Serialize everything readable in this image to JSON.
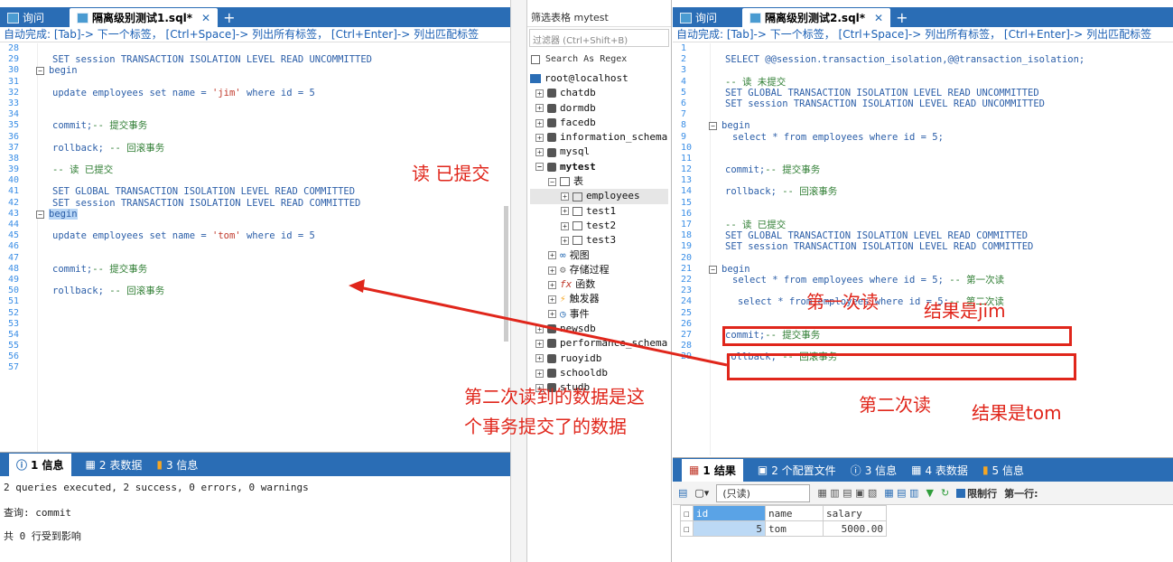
{
  "left": {
    "tabs": [
      "询问",
      "隔离级别测试1.sql*"
    ],
    "hint": "自动完成: [Tab]-> 下一个标签， [Ctrl+Space]-> 列出所有标签， [Ctrl+Enter]-> 列出匹配标签",
    "line_numbers": [
      "28",
      "29",
      "30",
      "31",
      "32",
      "33",
      "34",
      "35",
      "36",
      "37",
      "38",
      "39",
      "40",
      "41",
      "42",
      "43",
      "44",
      "45",
      "46",
      "47",
      "48",
      "49",
      "50",
      "51",
      "52",
      "53",
      "54",
      "55",
      "56",
      "57"
    ],
    "code": {
      "l29": "SET session TRANSACTION ISOLATION LEVEL READ UNCOMMITTED",
      "l30": "begin",
      "l32a": "update employees set name = ",
      "l32s": "'jim'",
      "l32b": " where id = 5",
      "l35a": "commit;",
      "l35b": "-- 提交事务",
      "l37a": "rollback;",
      "l37b": " -- 回滚事务",
      "l39": "-- 读 已提交",
      "l41": "SET GLOBAL TRANSACTION ISOLATION LEVEL READ COMMITTED",
      "l42": "SET session TRANSACTION ISOLATION LEVEL READ COMMITTED",
      "l43": "begin",
      "l45a": "update employees set name = ",
      "l45s": "'tom'",
      "l45b": " where id = 5",
      "l48a": "commit;",
      "l48b": "-- 提交事务",
      "l50a": "rollback;",
      "l50b": " -- 回滚事务"
    },
    "bottom_tabs": [
      "1 信息",
      "2 表数据",
      "3 信息"
    ],
    "messages": [
      "2 queries executed, 2 success, 0 errors, 0 warnings",
      "查询: commit",
      "共 0 行受到影响"
    ]
  },
  "middle": {
    "filter_label": "筛选表格 mytest",
    "filter_placeholder": "过滤器 (Ctrl+Shift+B)",
    "regex_label": "Search As Regex",
    "root": "root@localhost",
    "dbs_top": [
      "chatdb",
      "dormdb",
      "facedb",
      "information_schema",
      "mysql"
    ],
    "current_db": "mytest",
    "tables_label": "表",
    "tables": [
      "employees",
      "test1",
      "test2",
      "test3"
    ],
    "objects": [
      "视图",
      "存储过程",
      "函数",
      "触发器",
      "事件"
    ],
    "dbs_bottom": [
      "newsdb",
      "performance_schema",
      "ruoyidb",
      "schooldb",
      "studb"
    ]
  },
  "right": {
    "tabs": [
      "询问",
      "隔离级别测试2.sql*"
    ],
    "hint": "自动完成: [Tab]-> 下一个标签， [Ctrl+Space]-> 列出所有标签， [Ctrl+Enter]-> 列出匹配标签",
    "line_numbers": [
      "1",
      "2",
      "3",
      "4",
      "5",
      "6",
      "7",
      "8",
      "9",
      "10",
      "11",
      "12",
      "13",
      "14",
      "15",
      "16",
      "17",
      "18",
      "19",
      "20",
      "21",
      "22",
      "23",
      "24",
      "25",
      "26",
      "27",
      "28",
      "29"
    ],
    "code": {
      "l2": "SELECT @@session.transaction_isolation,@@transaction_isolation;",
      "l4": "-- 读 未提交",
      "l5": "SET GLOBAL TRANSACTION ISOLATION LEVEL READ UNCOMMITTED",
      "l6": "SET session TRANSACTION ISOLATION LEVEL READ UNCOMMITTED",
      "l8": "begin",
      "l9": "select * from employees where id = 5;",
      "l12a": "commit;",
      "l12b": "-- 提交事务",
      "l14a": "rollback;",
      "l14b": " -- 回滚事务",
      "l17": "-- 读 已提交",
      "l18": "SET GLOBAL TRANSACTION ISOLATION LEVEL READ COMMITTED",
      "l19": "SET session TRANSACTION ISOLATION LEVEL READ COMMITTED",
      "l21": "begin",
      "l22a": "select * from employees where id = 5; ",
      "l22b": "-- 第一次读",
      "l24a": "select * from employees where id = 5;",
      "l24b": "-- 第二次读",
      "l27a": "commit;",
      "l27b": "-- 提交事务",
      "l29a": "rollback;",
      "l29b": " -- 回滚事务"
    },
    "bottom_tabs": [
      "1 结果",
      "2 个配置文件",
      "3 信息",
      "4 表数据",
      "5 信息"
    ],
    "readonly": "(只读)",
    "limit_label": "限制行",
    "first_row_label": "第一行:",
    "columns": [
      "id",
      "name",
      "salary"
    ],
    "rows": [
      [
        "5",
        "tom",
        "5000.00"
      ]
    ]
  },
  "annotations": {
    "read_committed": "读 已提交",
    "first_read": "第一次读",
    "result_jim": "结果是jim",
    "second_read": "第二次读",
    "result_tom": "结果是tom",
    "explain_1": "第二次读到的数据是这",
    "explain_2": "个事务提交了的数据"
  },
  "colors": {
    "accent": "#2a6db5",
    "annotation": "#e0261b"
  }
}
